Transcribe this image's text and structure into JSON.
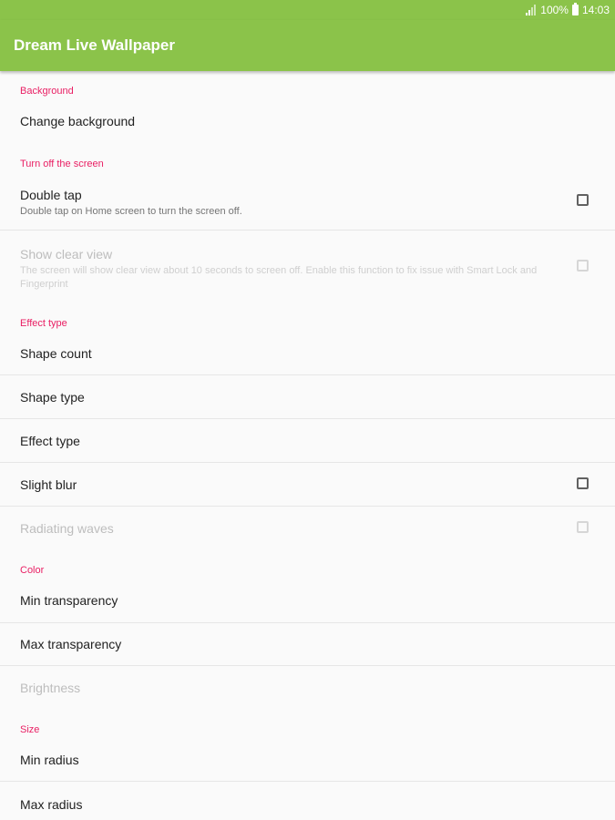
{
  "status_bar": {
    "battery": "100%",
    "time": "14:03"
  },
  "app_bar": {
    "title": "Dream Live Wallpaper",
    "color": "#8bc34a"
  },
  "accent_color": "#e91e63",
  "sections": {
    "background": {
      "header": "Background",
      "change_background": "Change background"
    },
    "turn_off": {
      "header": "Turn off the screen",
      "double_tap": {
        "title": "Double tap",
        "summary": "Double tap on Home screen to turn the screen off.",
        "checked": false
      },
      "show_clear_view": {
        "title": "Show clear view",
        "summary": "The screen will show clear view about 10 seconds to screen off. Enable this function to fix issue with Smart Lock and Fingerprint",
        "enabled": false,
        "checked": false
      }
    },
    "effect_type": {
      "header": "Effect type",
      "shape_count": "Shape count",
      "shape_type": "Shape type",
      "effect_type": "Effect type",
      "slight_blur": {
        "title": "Slight blur",
        "checked": false
      },
      "radiating_waves": {
        "title": "Radiating waves",
        "enabled": false,
        "checked": false
      }
    },
    "color": {
      "header": "Color",
      "min_transparency": "Min transparency",
      "max_transparency": "Max transparency",
      "brightness": "Brightness"
    },
    "size": {
      "header": "Size",
      "min_radius": "Min radius",
      "max_radius": "Max radius"
    }
  }
}
